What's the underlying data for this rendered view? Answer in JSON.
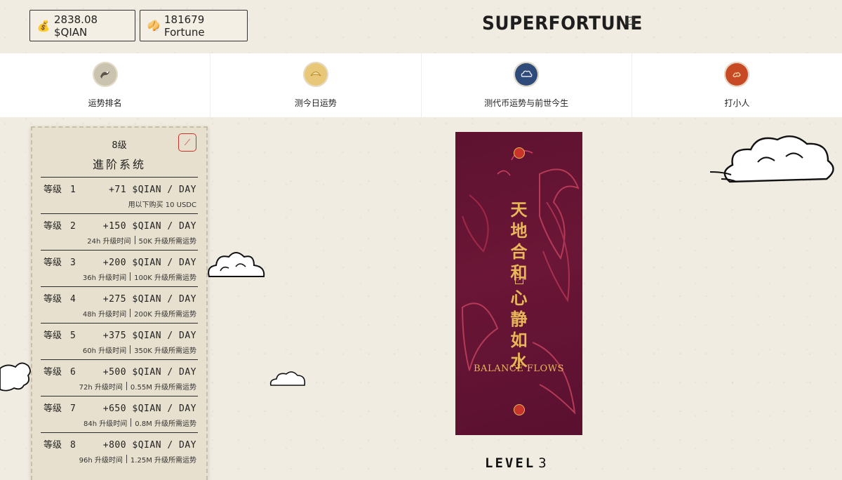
{
  "header": {
    "qian_balance": "2838.08 $QIAN",
    "fortune_balance": "181679 Fortune",
    "logo": "SUPERFORTUNE"
  },
  "nav": [
    {
      "label": "运势排名",
      "icon": "dragon-badge-icon",
      "color": "#c9c3b0"
    },
    {
      "label": "测今日运势",
      "icon": "fortune-cookie-badge-icon",
      "color": "#e8c878"
    },
    {
      "label": "测代币运势与前世今生",
      "icon": "cloud-badge-icon",
      "color": "#2f4b7a"
    },
    {
      "label": "打小人",
      "icon": "fire-badge-icon",
      "color": "#c84a25"
    }
  ],
  "panel": {
    "level_text": "8级",
    "title": "進阶系统",
    "tiers": [
      {
        "label": "等级",
        "num": "1",
        "rate": "+71  $QIAN / DAY",
        "sub1": "用以下购买 10 USDC",
        "sub2": ""
      },
      {
        "label": "等级",
        "num": "2",
        "rate": "+150 $QIAN / DAY",
        "sub1": "24h 升级时间",
        "sub2": "50K 升级所需运势"
      },
      {
        "label": "等级",
        "num": "3",
        "rate": "+200 $QIAN / DAY",
        "sub1": "36h 升级时间",
        "sub2": "100K 升级所需运势"
      },
      {
        "label": "等级",
        "num": "4",
        "rate": "+275 $QIAN / DAY",
        "sub1": "48h 升级时间",
        "sub2": "200K 升级所需运势"
      },
      {
        "label": "等级",
        "num": "5",
        "rate": "+375 $QIAN / DAY",
        "sub1": "60h 升级时间",
        "sub2": "350K 升级所需运势"
      },
      {
        "label": "等级",
        "num": "6",
        "rate": "+500 $QIAN / DAY",
        "sub1": "72h 升级时间",
        "sub2": "0.55M 升级所需运势"
      },
      {
        "label": "等级",
        "num": "7",
        "rate": "+650 $QIAN / DAY",
        "sub1": "84h 升级时间",
        "sub2": "0.8M 升级所需运势"
      },
      {
        "label": "等级",
        "num": "8",
        "rate": "+800 $QIAN / DAY",
        "sub1": "96h 升级时间",
        "sub2": "1.25M 升级所需运势"
      }
    ]
  },
  "card": {
    "line1": "天地合和",
    "line2": "心静如水",
    "balance_text": "BALANCE FLOWS"
  },
  "level": {
    "label": "LEVEL",
    "value": "3"
  }
}
